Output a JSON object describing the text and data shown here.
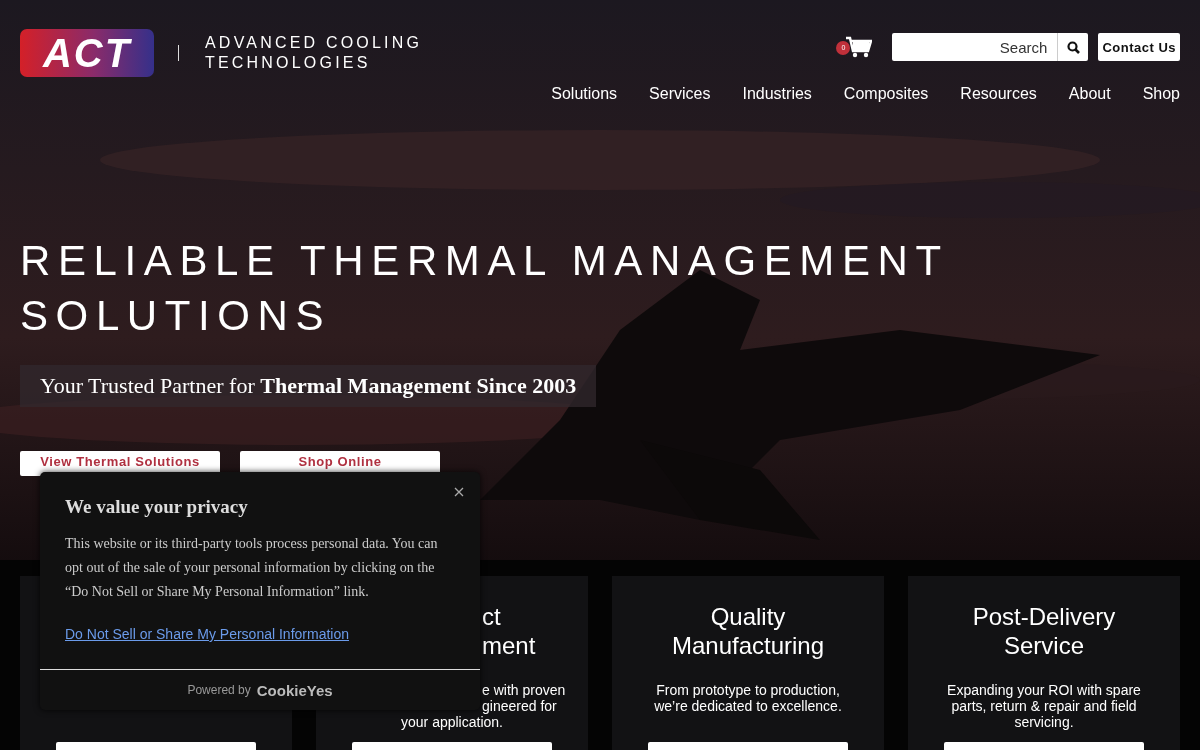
{
  "header": {
    "logo": "ACT",
    "brand_lines": [
      "ADVANCED COOLING",
      "TECHNOLOGIES"
    ],
    "cart_count": "0",
    "search": {
      "placeholder": "Search"
    },
    "contact_button": "Contact Us"
  },
  "nav": [
    "Solutions",
    "Services",
    "Industries",
    "Composites",
    "Resources",
    "About",
    "Shop"
  ],
  "hero": {
    "title": "RELIABLE THERMAL MANAGEMENT SOLUTIONS",
    "subtitle": "Your Trusted Partner for **Thermal Management Since 2003**",
    "buttons": [
      "View Thermal Solutions",
      "Shop Online"
    ]
  },
  "cards": [
    {
      "kind": "covered"
    },
    {
      "kind": "partly_covered",
      "title": [
        "ct",
        "ment"
      ],
      "text": [
        "e with proven",
        "gineered for",
        "your application."
      ]
    },
    {
      "kind": "full",
      "title": [
        "Quality",
        "Manufacturing"
      ],
      "text": [
        "From prototype to production,",
        "we’re dedicated to excellence."
      ]
    },
    {
      "kind": "full",
      "title": [
        "Post-Delivery",
        "Service"
      ],
      "text": [
        "Expanding your ROI with spare",
        "parts, return & repair and field",
        "servicing."
      ]
    }
  ],
  "cookie_popup": {
    "title": "We value your privacy",
    "body": "This website or its third-party tools process personal data. You can opt out of the sale of your personal information by clicking on the “Do Not Sell or Share My Personal Information” link.",
    "link": "Do Not Sell or Share My Personal Information",
    "powered_by": "Powered by",
    "brand": "CookieYes"
  }
}
